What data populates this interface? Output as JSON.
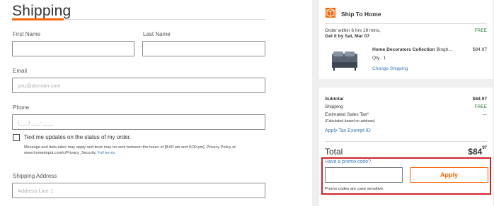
{
  "form": {
    "title": "Shipping",
    "first_name_label": "First Name",
    "last_name_label": "Last Name",
    "email_label": "Email",
    "email_placeholder": "you@domain.com",
    "phone_label": "Phone",
    "phone_placeholder": "(___) ___-____",
    "sms_checkbox_label": "Text me updates on the status of my order.",
    "sms_note": "Message and data rates may apply and texts may be sent between the hours of [8:00 am and 9:00 pm]. Privacy Policy at www.homedepot.com/c/Privacy_Security.",
    "full_terms_link": "Full terms",
    "shipping_address_label": "Shipping Address",
    "address_placeholder": "Address Line 1"
  },
  "ship_to_home": {
    "title": "Ship To Home",
    "order_within": "Order within 6 hrs 19 mins,",
    "get_it_by": "Get it by Sat, Mar 07",
    "shipping_cost": "FREE",
    "product_name": "Home Decorators Collection",
    "product_name_rest": "Bingh...",
    "product_price": "$84.97",
    "qty": "Qty : 1",
    "change_shipping": "Change Shipping"
  },
  "summary": {
    "subtotal_label": "Subtotal",
    "subtotal_value": "$84.97",
    "shipping_label": "Shipping",
    "shipping_value": "FREE",
    "tax_label": "Estimated Sales Tax*",
    "tax_value": "---",
    "tax_note": "(Calculated based on address)",
    "tax_exempt_link": "Apply Tax Exempt ID",
    "total_label": "Total",
    "total_dollars": "$84",
    "total_cents": "97"
  },
  "promo": {
    "link": "Have a promo code?",
    "apply_label": "Apply",
    "note": "Promo codes are case sensitive."
  },
  "colors": {
    "accent_orange": "#f96302",
    "highlight_red": "#d4202b",
    "link_blue": "#3e7ab8",
    "free_green": "#1f7a36"
  }
}
